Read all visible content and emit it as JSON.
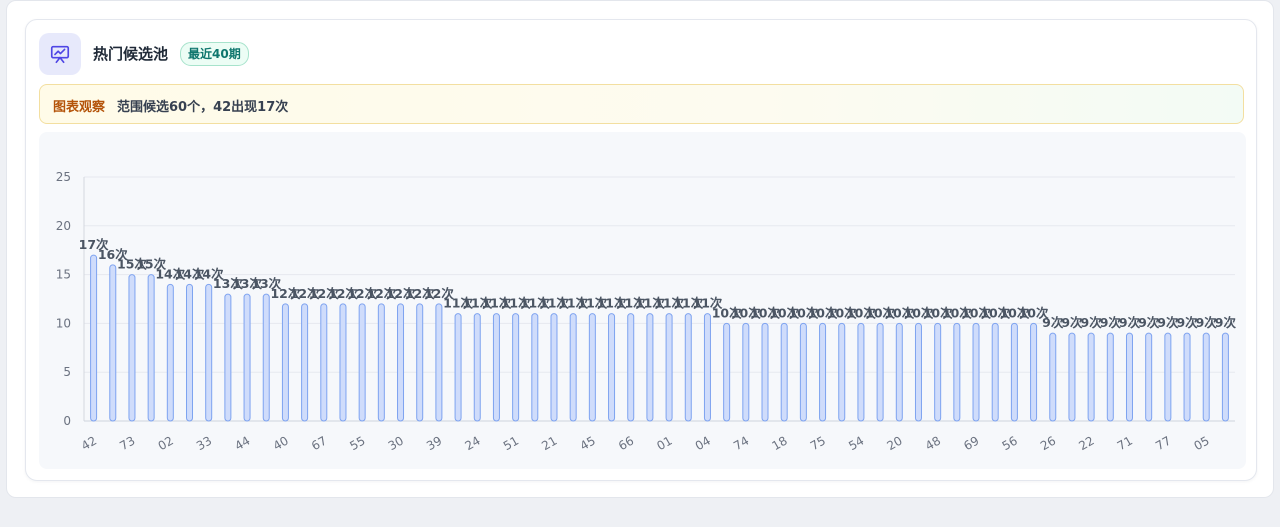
{
  "header": {
    "title": "热门候选池",
    "badge": "最近40期",
    "icon": "presentation-chart-icon"
  },
  "observation": {
    "label": "图表观察",
    "text": "范围候选60个，42出现17次"
  },
  "colors": {
    "bar_fill": "#cfdcfb",
    "bar_stroke": "#7ea3f0",
    "badge_text": "#0f766e",
    "obs_label": "#b45309"
  },
  "chart_data": {
    "type": "bar",
    "ylim": [
      0,
      25
    ],
    "yticks": [
      0,
      5,
      10,
      15,
      20,
      25
    ],
    "grid": true,
    "value_suffix": "次",
    "categories": [
      "42",
      "73",
      "02",
      "33",
      "44",
      "40",
      "67",
      "55",
      "30",
      "39",
      "24",
      "51",
      "21",
      "45",
      "66",
      "01",
      "04",
      "74",
      "18",
      "75",
      "54",
      "20",
      "48",
      "69",
      "56",
      "26",
      "22",
      "71",
      "77",
      "05"
    ],
    "bar_values": [
      17,
      16,
      15,
      15,
      14,
      14,
      14,
      13,
      13,
      13,
      12,
      12,
      12,
      12,
      12,
      12,
      12,
      12,
      12,
      11,
      11,
      11,
      11,
      11,
      11,
      11,
      11,
      11,
      11,
      11,
      11,
      11,
      11,
      10,
      10,
      10,
      10,
      10,
      10,
      10,
      10,
      10,
      10,
      10,
      10,
      10,
      10,
      10,
      10,
      10,
      9,
      9,
      9,
      9,
      9,
      9,
      9,
      9,
      9,
      9
    ]
  }
}
